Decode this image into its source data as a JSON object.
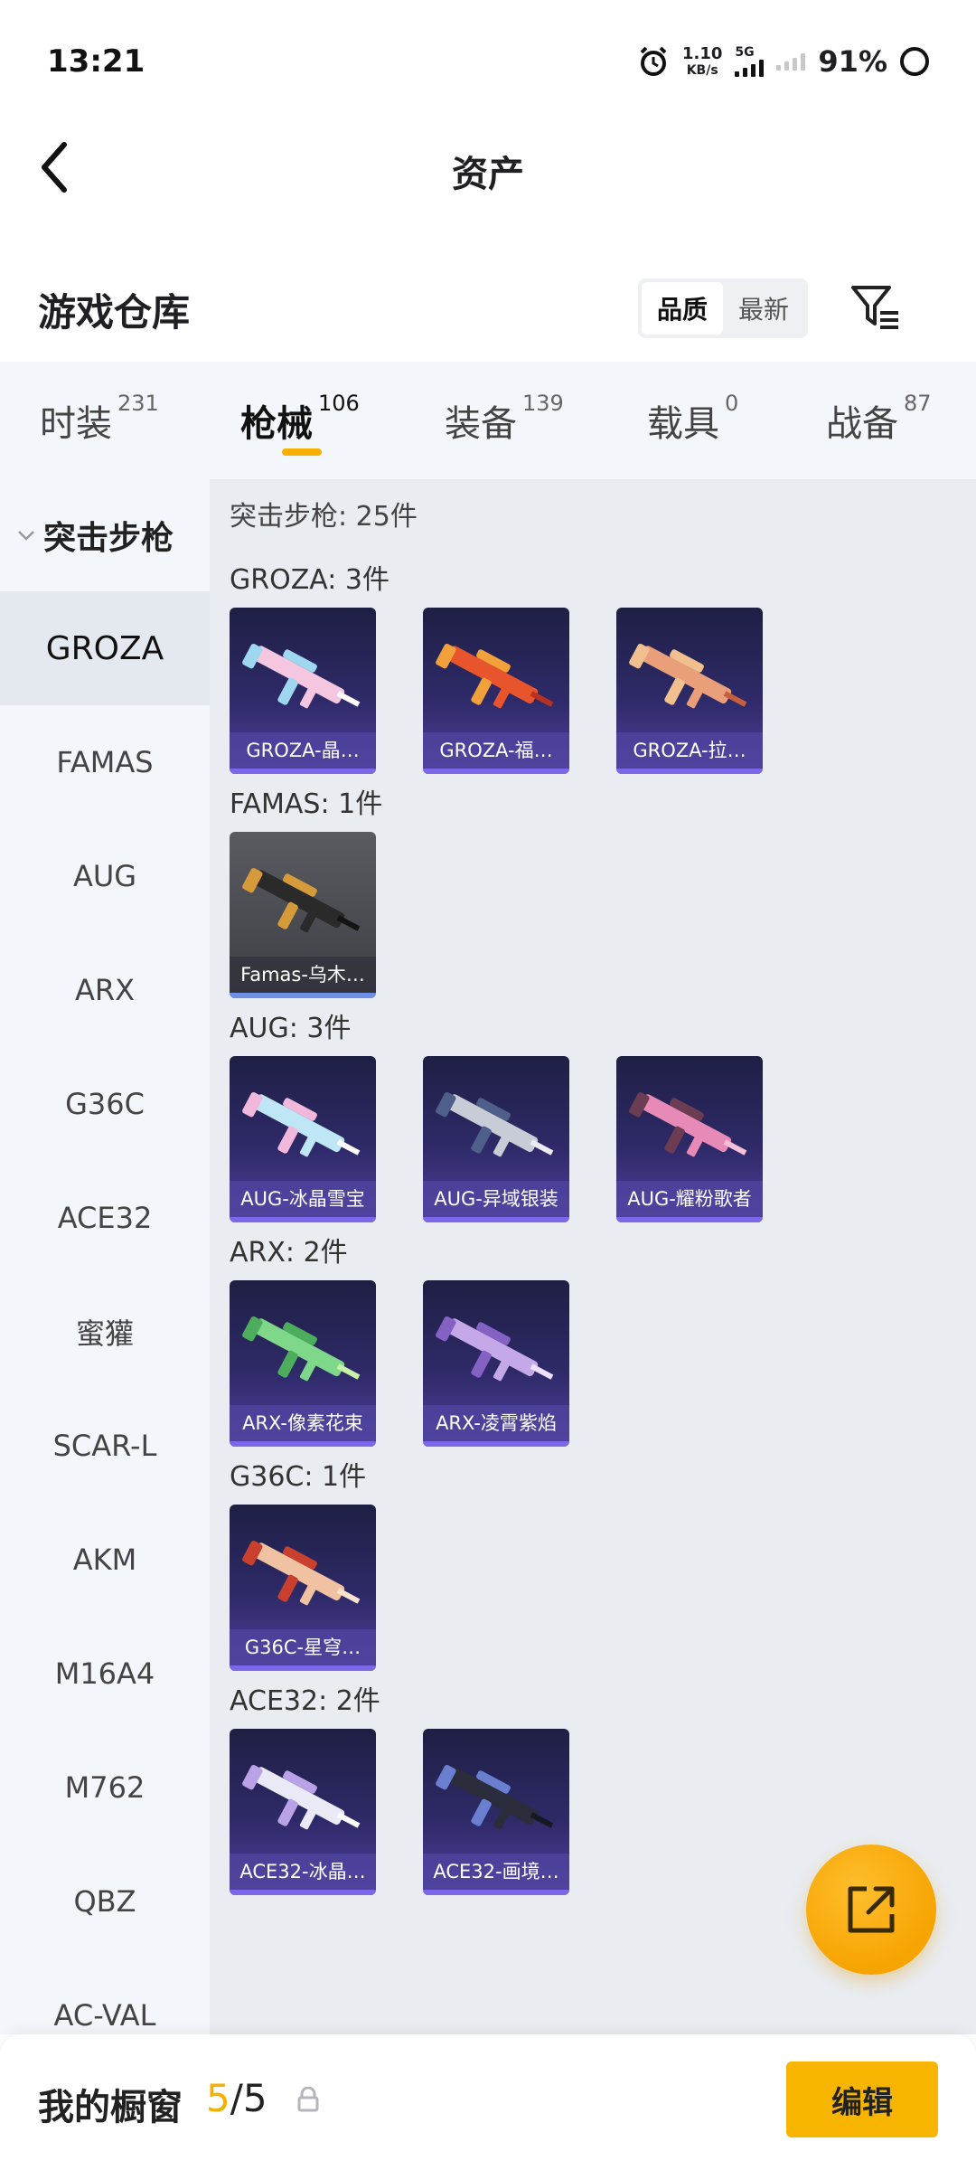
{
  "status_bar": {
    "time": "13:21",
    "net_speed_value": "1.10",
    "net_speed_unit": "KB/s",
    "network_type": "5G",
    "battery": "91%"
  },
  "header": {
    "title": "资产",
    "back_icon": "chevron-left-icon"
  },
  "section": {
    "title": "游戏仓库",
    "sort_options": [
      "品质",
      "最新"
    ],
    "sort_selected": "品质",
    "filter_icon": "filter-icon"
  },
  "tabs": [
    {
      "label": "时装",
      "count": "231",
      "active": false
    },
    {
      "label": "枪械",
      "count": "106",
      "active": true
    },
    {
      "label": "装备",
      "count": "139",
      "active": false
    },
    {
      "label": "载具",
      "count": "0",
      "active": false
    },
    {
      "label": "战备",
      "count": "87",
      "active": false
    }
  ],
  "sidebar": {
    "group_label": "突击步枪",
    "items": [
      "GROZA",
      "FAMAS",
      "AUG",
      "ARX",
      "G36C",
      "ACE32",
      "蜜獾",
      "SCAR-L",
      "AKM",
      "M16A4",
      "M762",
      "QBZ",
      "AC-VAL"
    ],
    "selected": "GROZA"
  },
  "content": {
    "summary": "突击步枪: 25件",
    "groups": [
      {
        "title": "GROZA: 3件",
        "items": [
          {
            "name": "GROZA-晶…",
            "colors": [
              "#f4c6e0",
              "#9fd6f0",
              "#ffffff"
            ]
          },
          {
            "name": "GROZA-福…",
            "colors": [
              "#e8552c",
              "#f2a13a",
              "#b83222"
            ]
          },
          {
            "name": "GROZA-拉…",
            "colors": [
              "#e9a07a",
              "#f1c08e",
              "#c5603f"
            ]
          }
        ]
      },
      {
        "title": "FAMAS: 1件",
        "items": [
          {
            "name": "Famas-乌木…",
            "legacy": true,
            "colors": [
              "#2a2a2a",
              "#d59a3a",
              "#141414"
            ]
          }
        ]
      },
      {
        "title": "AUG: 3件",
        "items": [
          {
            "name": "AUG-冰晶雪宝",
            "colors": [
              "#bfe6f5",
              "#f2b8dc",
              "#ffffff"
            ]
          },
          {
            "name": "AUG-异域银装",
            "colors": [
              "#c8ccd6",
              "#4e5f8a",
              "#e9ecf2"
            ]
          },
          {
            "name": "AUG-耀粉歌者",
            "colors": [
              "#e78ab8",
              "#6c3d52",
              "#f5c0d8"
            ]
          }
        ]
      },
      {
        "title": "ARX: 2件",
        "items": [
          {
            "name": "ARX-像素花束",
            "colors": [
              "#7fd88a",
              "#4cae5c",
              "#c8f2a8"
            ]
          },
          {
            "name": "ARX-凌霄紫焰",
            "colors": [
              "#c4a8e8",
              "#8462c4",
              "#ece0fb"
            ]
          }
        ]
      },
      {
        "title": "G36C: 1件",
        "items": [
          {
            "name": "G36C-星穹…",
            "colors": [
              "#f1c2a2",
              "#c9402f",
              "#fbe2cf"
            ]
          }
        ]
      },
      {
        "title": "ACE32: 2件",
        "items": [
          {
            "name": "ACE32-冰晶…",
            "colors": [
              "#e9eaf5",
              "#b9a2e6",
              "#ffffff"
            ]
          },
          {
            "name": "ACE32-画境…",
            "colors": [
              "#2b2c3c",
              "#6a7fd0",
              "#181822"
            ]
          }
        ]
      }
    ]
  },
  "fab": {
    "icon": "external-link-icon"
  },
  "bottom_bar": {
    "label": "我的橱窗",
    "count_current": "5",
    "count_total": "/5",
    "lock_icon": "lock-icon",
    "edit_label": "编辑"
  },
  "colors": {
    "accent": "#f5b000",
    "sidebar_bg": "#f3f6fa",
    "content_bg": "#e9edf2",
    "card_bg": "#2e2a68"
  }
}
